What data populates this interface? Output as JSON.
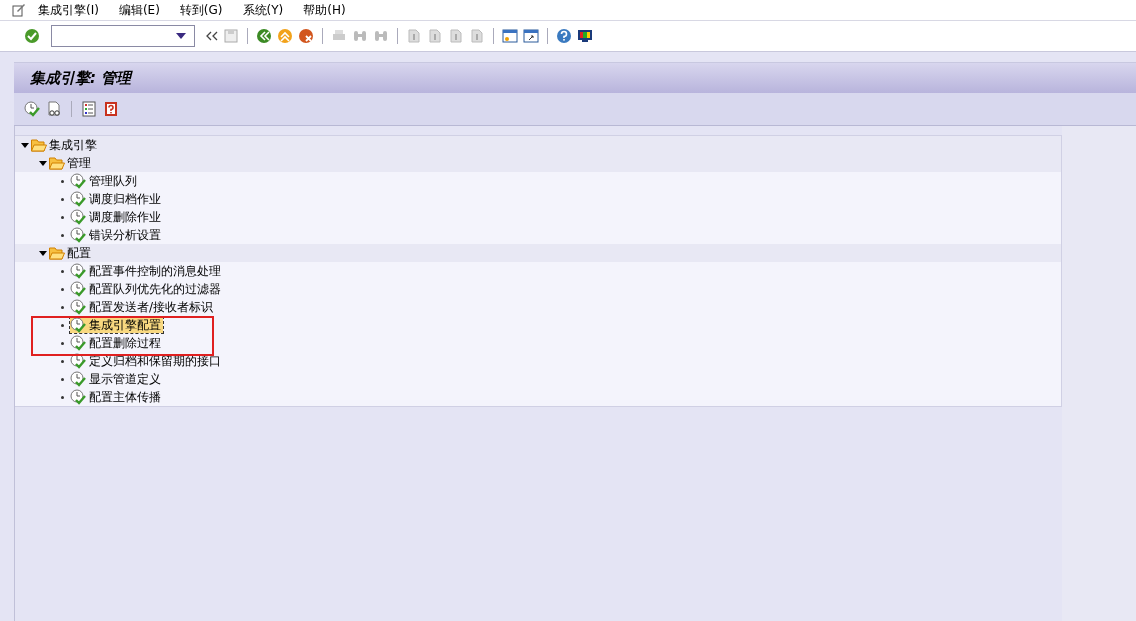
{
  "menu_bar": {
    "items": [
      "集成引擎(I)",
      "编辑(E)",
      "转到(G)",
      "系统(Y)",
      "帮助(H)"
    ]
  },
  "title_bar": {
    "title": "集成引擎: 管理"
  },
  "tree": [
    {
      "label": "集成引擎",
      "kind": "folder",
      "expanded": true,
      "children": [
        {
          "label": "管理",
          "kind": "folder",
          "expanded": true,
          "children": [
            {
              "label": "管理队列",
              "kind": "transaction",
              "selected": false
            },
            {
              "label": "调度归档作业",
              "kind": "transaction",
              "selected": false
            },
            {
              "label": "调度删除作业",
              "kind": "transaction",
              "selected": false
            },
            {
              "label": "错误分析设置",
              "kind": "transaction",
              "selected": false
            }
          ]
        },
        {
          "label": "配置",
          "kind": "folder",
          "expanded": true,
          "children": [
            {
              "label": "配置事件控制的消息处理",
              "kind": "transaction",
              "selected": false
            },
            {
              "label": "配置队列优先化的过滤器",
              "kind": "transaction",
              "selected": false
            },
            {
              "label": "配置发送者/接收者标识",
              "kind": "transaction",
              "selected": false
            },
            {
              "label": "集成引擎配置",
              "kind": "transaction",
              "selected": true
            },
            {
              "label": "配置删除过程",
              "kind": "transaction",
              "selected": false
            },
            {
              "label": "定义归档和保留期的接口",
              "kind": "transaction",
              "selected": false
            },
            {
              "label": "显示管道定义",
              "kind": "transaction",
              "selected": false
            },
            {
              "label": "配置主体传播",
              "kind": "transaction",
              "selected": false
            }
          ]
        }
      ]
    }
  ]
}
